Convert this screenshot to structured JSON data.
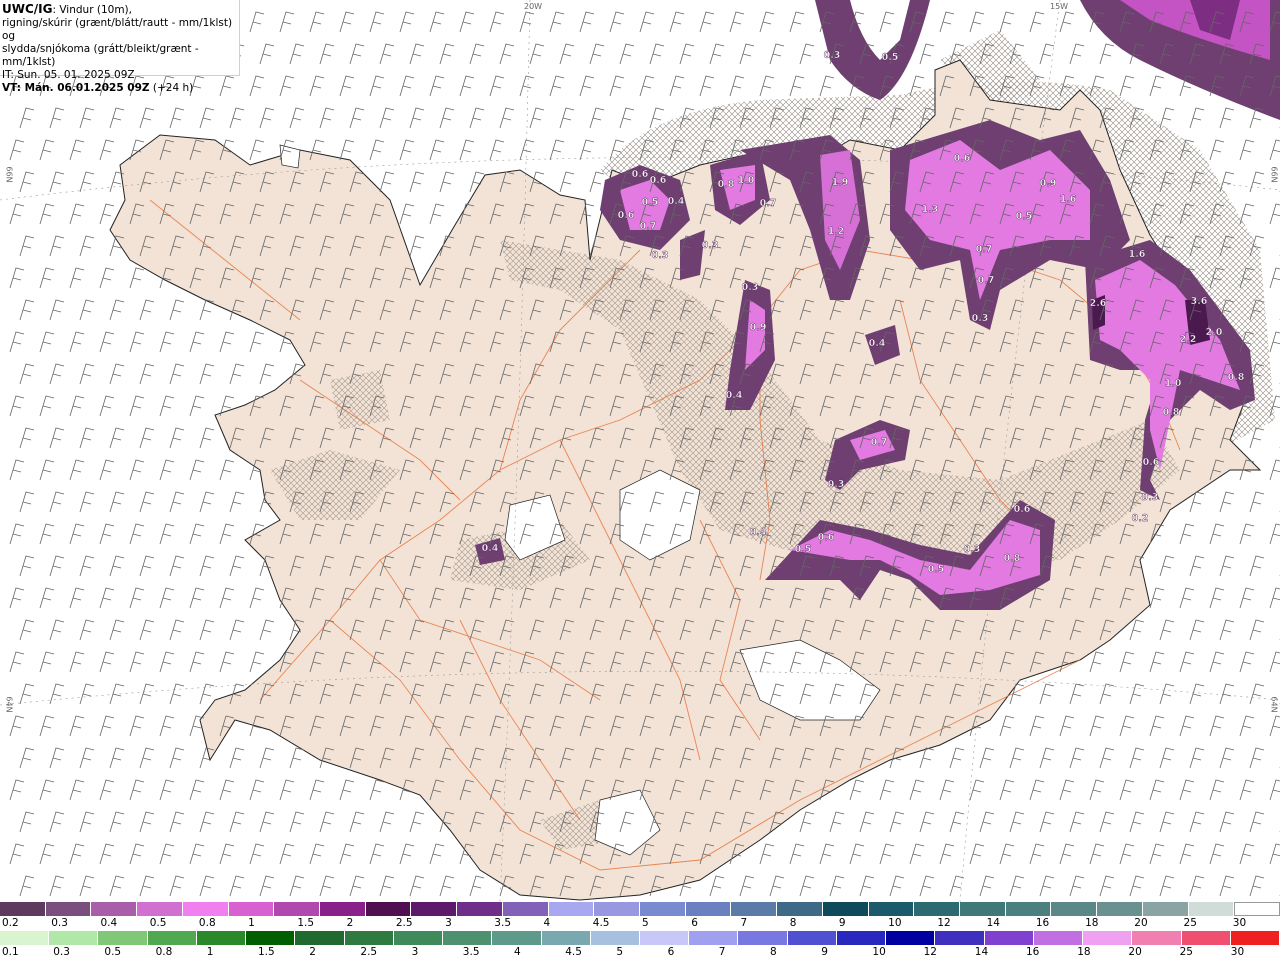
{
  "header": {
    "brand": "UWC/IG",
    "line1_rest": ": Vindur (10m),",
    "line2": "rigning/skúrir (grænt/blátt/rautt - mm/1klst) og",
    "line3": "slydda/snjókoma (grátt/bleikt/grænt - mm/1klst)",
    "line4": "IT: Sun. 05. 01. 2025 09Z",
    "line5_bold": "VT: Mán. 06.01.2025 09Z",
    "line5_rest": " (+24 h)"
  },
  "edge_labels": {
    "top1": "20W",
    "top2": "15W",
    "left1": "66N",
    "left2": "64N",
    "right1": "66N",
    "right2": "64N"
  },
  "colors": {
    "land": "#f2e3d6",
    "roads": "#e8743b",
    "sea": "#ffffff",
    "snow": "#ffffff"
  },
  "precip_labels": [
    "0.3",
    "0.5",
    "0.6",
    "0.6",
    "0.6",
    "0.5",
    "0.7",
    "0.4",
    "0.3",
    "0.3",
    "0.8",
    "1.0",
    "0.7",
    "1.9",
    "1.2",
    "0.3",
    "0.9",
    "0.4",
    "0.6",
    "1.3",
    "0.9",
    "1.6",
    "0.5",
    "0.7",
    "0.7",
    "0.3",
    "1.6",
    "2.6",
    "3.6",
    "2.2",
    "2.0",
    "0.8",
    "1.0",
    "0.8",
    "0.6",
    "0.3",
    "0.2",
    "0.4",
    "0.7",
    "0.3",
    "0.4",
    "0.5",
    "0.6",
    "0.8",
    "0.5",
    "0.6",
    "0.3",
    "0.4"
  ],
  "legend": {
    "snow_colors": [
      "#5e3a5e",
      "#7a4e7e",
      "#a85ea8",
      "#d070d0",
      "#f080f0",
      "#d860d0",
      "#b048b0",
      "#8a208a",
      "#501050",
      "#5e1a6a",
      "#6e2e8a",
      "#8262b8",
      "#a8a8f0",
      "#9898e0",
      "#7a8ad0",
      "#6a80c0",
      "#5a7aa8",
      "#3e6a88",
      "#0e4a5a",
      "#1a5a6a",
      "#2a6a70",
      "#3e7878",
      "#4a8080",
      "#5a8888",
      "#6a9090",
      "#8aa4a4",
      "#d0dcd8",
      "#ffffff"
    ],
    "snow_ticks": [
      "0.2",
      "0.3",
      "0.4",
      "0.5",
      "0.8",
      "1",
      "1.5",
      "2",
      "2.5",
      "3",
      "3.5",
      "4",
      "4.5",
      "5",
      "6",
      "7",
      "8",
      "9",
      "10",
      "12",
      "14",
      "16",
      "18",
      "20",
      "25",
      "30"
    ],
    "rain_colors": [
      "#d8f5d0",
      "#b0e8a8",
      "#80c878",
      "#50a850",
      "#2a8a2a",
      "#006000",
      "#206a30",
      "#2e7a40",
      "#3e8a5a",
      "#4e9070",
      "#5e9a8a",
      "#7aa8b0",
      "#a8c0e0",
      "#c8c8f8",
      "#a0a0f0",
      "#7878e0",
      "#5050d0",
      "#2828c0",
      "#0000a0",
      "#4030c0",
      "#8040d0",
      "#c070e0",
      "#f0a0f0",
      "#f080b0",
      "#f05070",
      "#f02020"
    ],
    "rain_ticks": [
      "0.1",
      "0.3",
      "0.5",
      "0.8",
      "1",
      "1.5",
      "2",
      "2.5",
      "3",
      "3.5",
      "4",
      "4.5",
      "5",
      "6",
      "7",
      "8",
      "9",
      "10",
      "12",
      "14",
      "16",
      "18",
      "20",
      "25",
      "30"
    ]
  }
}
